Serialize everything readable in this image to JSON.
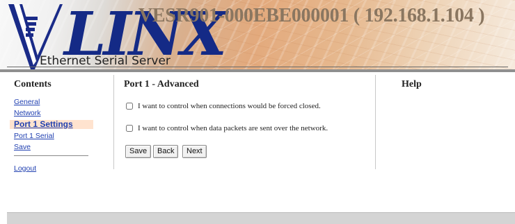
{
  "banner": {
    "logo_text": "LINX",
    "device_title": "VESR901-000EBE000001 ( 192.168.1.104 )",
    "product_name": "Ethernet Serial Server"
  },
  "sidebar": {
    "heading": "Contents",
    "items": [
      {
        "label": "General"
      },
      {
        "label": "Network"
      },
      {
        "label": "Port 1 Settings",
        "selected": true
      },
      {
        "label": "Port 1 Serial"
      },
      {
        "label": "Save"
      },
      {
        "label": "Logout"
      }
    ]
  },
  "main": {
    "title": "Port 1 - Advanced",
    "options": [
      {
        "label": "I want to control when connections would be forced closed.",
        "checked": false
      },
      {
        "label": "I want to control when data packets are sent over the network.",
        "checked": false
      }
    ],
    "buttons": {
      "save": "Save",
      "back": "Back",
      "next": "Next"
    }
  },
  "help": {
    "heading": "Help"
  },
  "colors": {
    "link": "#1f3fb0",
    "logo_blue": "#142a86",
    "selected_bg": "#ffe3cf",
    "title_brown": "#8a7660"
  }
}
